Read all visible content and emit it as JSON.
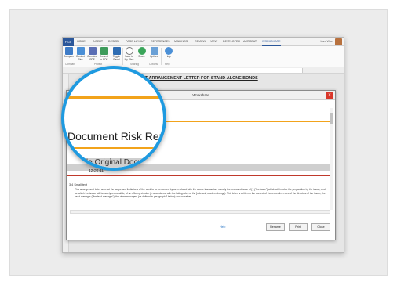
{
  "ribbon": {
    "file_tab": "FILE",
    "tabs": [
      "HOME",
      "INSERT",
      "DESIGN",
      "PAGE LAYOUT",
      "REFERENCES",
      "MAILINGS",
      "REVIEW",
      "VIEW",
      "DEVELOPER",
      "ACROBAT",
      "WORKSHARE"
    ],
    "active_tab": "WORKSHARE",
    "user": "Lara Wue",
    "buttons": [
      {
        "label": "Compare",
        "icon": "compare-icon"
      },
      {
        "label": "Content Risk",
        "icon": "content-risk-icon"
      },
      {
        "label": "Combine PDF",
        "icon": "combine-pdf-icon"
      },
      {
        "label": "Convert to PDF",
        "icon": "convert-pdf-icon"
      },
      {
        "label": "Toggle Panel",
        "icon": "toggle-panel-icon"
      },
      {
        "label": "Save to My Files",
        "icon": "save-cloud-icon"
      },
      {
        "label": "Share",
        "icon": "share-icon"
      },
      {
        "label": "Options",
        "icon": "options-icon"
      },
      {
        "label": "Help",
        "icon": "help-icon"
      }
    ],
    "groups": [
      "Compare",
      "Protect",
      "Sharing",
      "Options",
      "Help"
    ]
  },
  "document": {
    "title": "DRAFT ARRANGEMENT LETTER FOR STAND-ALONE BONDS"
  },
  "dialog": {
    "title": "Workshare",
    "time_small": "12:26:11",
    "section": "3.4 Small text",
    "body": "This arrangement letter sets out the scope and limitations of the work to be performed by us in related with the above transaction, namely the proposed issue of [ ] (\"the issue\") which will involve the preparation by the issuer, and for which the issuer will be solely responsible, of an offering circular (in accordance with the listing rules of the [relevant] stock exchange). This letter is written in the context of the respective roles of the directors of the issuer, the head manager (\"the lead manager\"), the other managers (as defined in paragraph 2 below) and ourselves.",
    "help_link": "Help",
    "buttons": [
      "Rename",
      "Print",
      "Close"
    ]
  },
  "magnifier": {
    "title": "Document Risk Report",
    "subtitle": "mple Original Document",
    "time": "12:26:11"
  },
  "colors": {
    "word_blue": "#2b579a",
    "accent_orange": "#f2a31b",
    "lens_blue": "#1e9ae0",
    "close_red": "#d9372b"
  }
}
